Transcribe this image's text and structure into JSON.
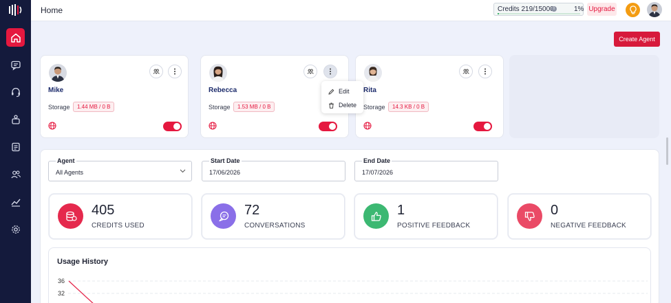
{
  "header": {
    "title": "Home",
    "credits_text": "Credits 219/15000",
    "credits_percent_text": "1%",
    "credits_fraction": 0.01,
    "upgrade_label": "Upgrade"
  },
  "sidebar": {
    "items": [
      {
        "icon": "home-icon",
        "active": true
      },
      {
        "icon": "chat-icon",
        "active": false
      },
      {
        "icon": "headset-icon",
        "active": false
      },
      {
        "icon": "robot-icon",
        "active": false
      },
      {
        "icon": "report-icon",
        "active": false
      },
      {
        "icon": "users-icon",
        "active": false
      },
      {
        "icon": "analytics-icon",
        "active": false
      },
      {
        "icon": "settings-icon",
        "active": false
      }
    ]
  },
  "create_agent_label": "Create Agent",
  "agents": [
    {
      "name": "Mike",
      "storage_label": "Storage",
      "storage": "1.44 MB / 0 B",
      "enabled": true
    },
    {
      "name": "Rebecca",
      "storage_label": "Storage",
      "storage": "1.53 MB / 0 B",
      "enabled": true
    },
    {
      "name": "Rita",
      "storage_label": "Storage",
      "storage": "14.3 KB / 0 B",
      "enabled": true
    }
  ],
  "menu": {
    "edit": "Edit",
    "delete": "Delete"
  },
  "filters": {
    "agent_label": "Agent",
    "agent_value": "All Agents",
    "start_label": "Start Date",
    "start_value": "17/06/2026",
    "end_label": "End Date",
    "end_value": "17/07/2026"
  },
  "stats": [
    {
      "value": "405",
      "label": "CREDITS USED",
      "color": "#e5294d"
    },
    {
      "value": "72",
      "label": "CONVERSATIONS",
      "color": "#8a6fe8"
    },
    {
      "value": "1",
      "label": "POSITIVE FEEDBACK",
      "color": "#3cb872"
    },
    {
      "value": "0",
      "label": "NEGATIVE FEEDBACK",
      "color": "#ea4a66"
    }
  ],
  "usage": {
    "title": "Usage History",
    "y_ticks": [
      "36",
      "32"
    ]
  },
  "chart_data": {
    "type": "line",
    "title": "Usage History",
    "yticks": [
      36,
      32
    ],
    "series": [
      {
        "values": [
          36,
          32
        ]
      }
    ]
  }
}
